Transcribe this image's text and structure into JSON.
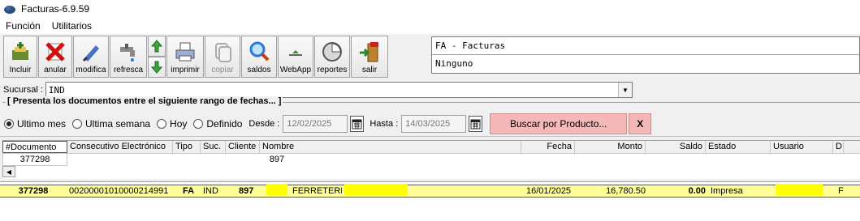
{
  "window": {
    "title": "Facturas-6.9.59"
  },
  "menu": [
    "Función",
    "Utilitarios"
  ],
  "toolbar": {
    "incluir": "Incluir",
    "anular": "anular",
    "modifica": "modifica",
    "refresca": "refresca",
    "imprimir": "imprimir",
    "copiar": "copiar",
    "saldos": "saldos",
    "webapp": "WebApp",
    "reportes": "reportes",
    "salir": "salir"
  },
  "info": {
    "line1": "FA - Facturas",
    "line2": "Ninguno"
  },
  "sucursal": {
    "label": "Sucursal :",
    "value": "IND"
  },
  "range": {
    "legend": "[ Presenta los documentos entre el siguiente rango de fechas... ]",
    "radios": [
      {
        "label": "Ultimo mes",
        "checked": true
      },
      {
        "label": "Ultima semana",
        "checked": false
      },
      {
        "label": "Hoy",
        "checked": false
      },
      {
        "label": "Definido",
        "checked": false
      }
    ],
    "desde_label": "Desde :",
    "desde_value": "12/02/2025",
    "hasta_label": "Hasta :",
    "hasta_value": "14/03/2025",
    "search_label": "Buscar por Producto...",
    "close_label": "X"
  },
  "grid1": {
    "columns": [
      "#Documento",
      "Consecutivo Electrónico",
      "Tipo",
      "Suc.",
      "Cliente",
      "Nombre",
      "Fecha",
      "Monto",
      "Saldo",
      "Estado",
      "Usuario",
      "D"
    ],
    "row": {
      "documento": "377298",
      "cliente": "897"
    }
  },
  "grid2": {
    "row": {
      "documento": "377298",
      "consecutivo": "00200001010000214991",
      "tipo": "FA",
      "suc": "IND",
      "cliente": "897",
      "nombre": "FERRETERIA",
      "fecha": "16/01/2025",
      "monto": "16,780.50",
      "saldo": "0.00",
      "estado": "Impresa",
      "extra": "F"
    }
  },
  "colors": {
    "row_highlight": "#ffff99",
    "redaction": "#ffff00",
    "search_button": "#f5b8b8"
  }
}
